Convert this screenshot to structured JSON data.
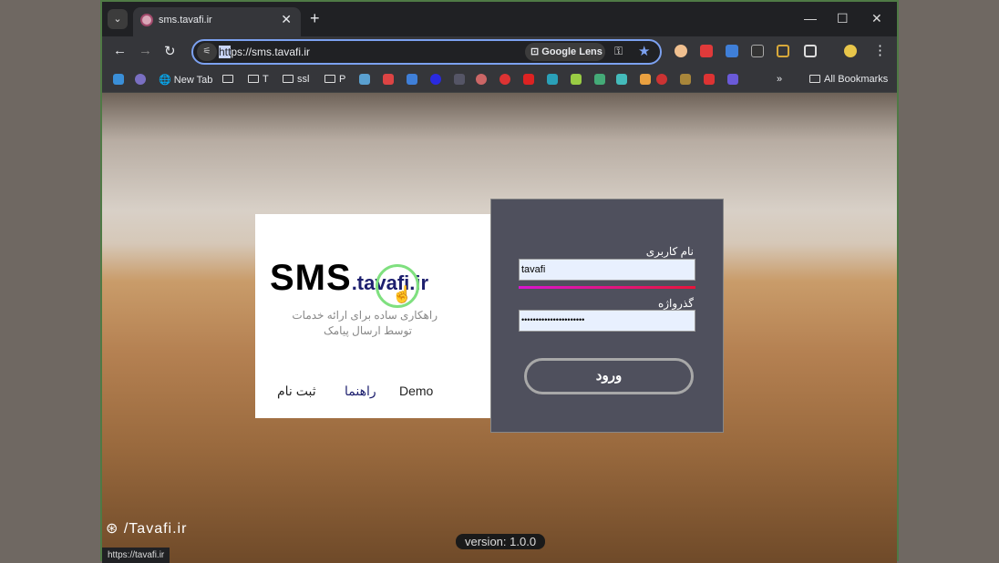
{
  "browser": {
    "tab_title": "sms.tavafi.ir",
    "url_highlight": "htt",
    "url_rest": "ps://sms.tavafi.ir",
    "google_lens": "Google Lens",
    "bookmarks": {
      "new_tab": "New Tab",
      "folder_t": "T",
      "folder_ssl": "ssl",
      "folder_p": "P",
      "all": "All Bookmarks",
      "more": "»"
    },
    "status_url": "https://tavafi.ir"
  },
  "left_card": {
    "logo_main": "SMS",
    "logo_domain": ".tavafi.ir",
    "tagline_1": "راهکاری ساده برای ارائه خدمات",
    "tagline_2": "توسط ارسال پیامک",
    "link_register": "ثبت نام",
    "link_help": "راهنما",
    "link_demo": "Demo"
  },
  "login": {
    "username_label": "نام کاربری",
    "username_value": "tavafi",
    "password_label": "گذرواژه",
    "password_value": "••••••••••••••••••••••",
    "submit": "ورود"
  },
  "watermark": "/Tavafi.ir",
  "version": "version: 1.0.0"
}
